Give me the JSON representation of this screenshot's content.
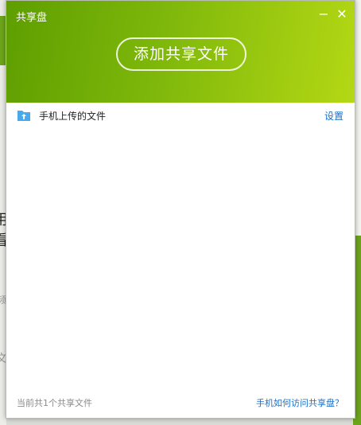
{
  "window": {
    "title": "共享盘",
    "minimize_glyph": "−",
    "close_glyph": "✕"
  },
  "header": {
    "add_button_label": "添加共享文件",
    "gradient_colors": [
      "#5e9e00",
      "#b4d814"
    ]
  },
  "files": [
    {
      "name": "手机上传的文件",
      "icon": "upload-folder-icon",
      "action_label": "设置"
    }
  ],
  "footer": {
    "count_text": "当前共1个共享文件",
    "help_link": "手机如何访问共享盘？"
  },
  "background": {
    "chars": [
      "用",
      "看",
      "频",
      "文"
    ]
  },
  "colors": {
    "accent": "#7fb80b",
    "link": "#1a6fc9",
    "icon_blue": "#4aa9ec"
  }
}
